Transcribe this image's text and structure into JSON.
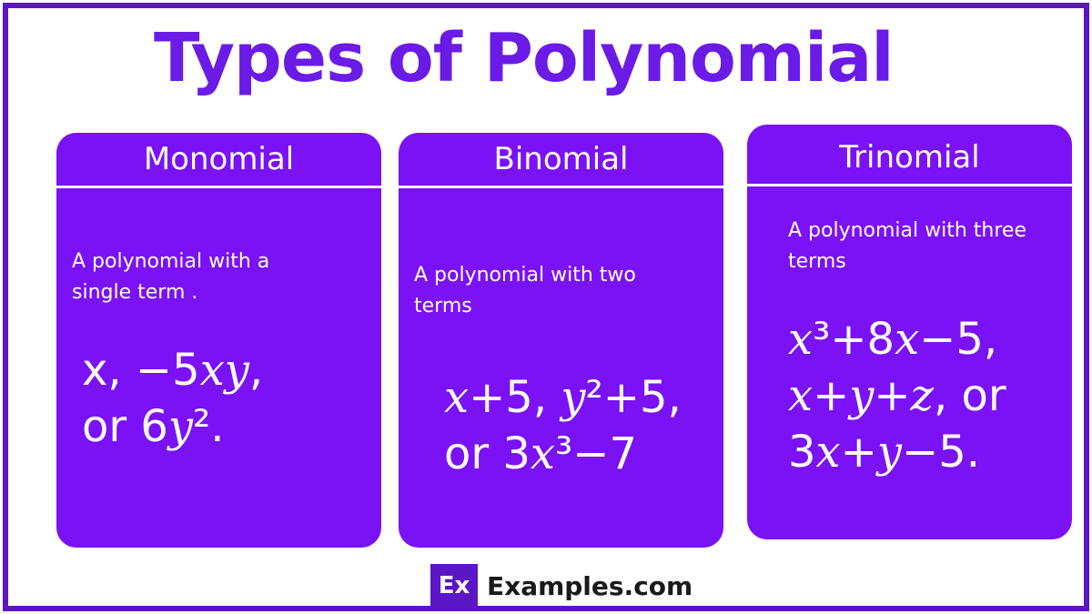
{
  "title": "Types of Polynomial",
  "colors": {
    "accent": "#6a1be6",
    "card_bg": "#7a12f5",
    "frame": "#5b16c7",
    "text_on_card": "#ffffff"
  },
  "cards": [
    {
      "heading": "Monomial",
      "description": "A polynomial with a\nsingle term .",
      "formula_lines": [
        [
          {
            "t": "x, −5"
          },
          {
            "t": "xy",
            "v": true
          },
          {
            "t": ","
          }
        ],
        [
          {
            "t": "or 6"
          },
          {
            "t": "y",
            "v": true
          },
          {
            "t": "²."
          }
        ]
      ]
    },
    {
      "heading": "Binomial",
      "description": " A polynomial with two\nterms",
      "formula_lines": [
        [
          {
            "t": "x",
            "v": true
          },
          {
            "t": "+5, "
          },
          {
            "t": "y",
            "v": true
          },
          {
            "t": "²+5,"
          }
        ],
        [
          {
            "t": "or 3"
          },
          {
            "t": "x",
            "v": true
          },
          {
            "t": "³−7"
          }
        ]
      ]
    },
    {
      "heading": "Trinomial",
      "description": "A polynomial with three\nterms",
      "formula_lines": [
        [
          {
            "t": "x",
            "v": true
          },
          {
            "t": "³+8"
          },
          {
            "t": "x",
            "v": true
          },
          {
            "t": "−5,"
          }
        ],
        [
          {
            "t": "x",
            "v": true
          },
          {
            "t": "+"
          },
          {
            "t": "y",
            "v": true
          },
          {
            "t": "+"
          },
          {
            "t": "z",
            "v": true
          },
          {
            "t": ", or"
          }
        ],
        [
          {
            "t": "3"
          },
          {
            "t": "x",
            "v": true
          },
          {
            "t": "+"
          },
          {
            "t": "y",
            "v": true
          },
          {
            "t": "−5."
          }
        ]
      ]
    }
  ],
  "brand": {
    "badge": "Ex",
    "name": "Examples.com"
  }
}
